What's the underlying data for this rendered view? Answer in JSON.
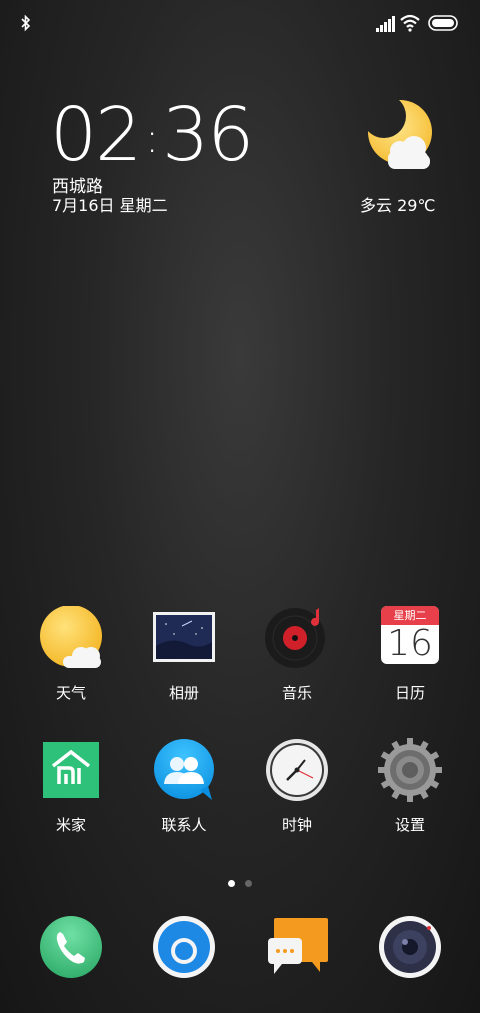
{
  "status_bar": {
    "bluetooth_icon": "bluetooth-icon",
    "signal_icon": "cellular-signal-icon",
    "wifi_icon": "wifi-icon",
    "battery_icon": "battery-icon"
  },
  "lock_widget": {
    "hour": "02",
    "separator": ":",
    "minute": "36",
    "location": "西城路",
    "date": "7月16日 星期二",
    "weather_icon": "moon-cloud-icon",
    "weather": "多云 29℃"
  },
  "apps": [
    {
      "label": "天气",
      "icon": "weather-icon"
    },
    {
      "label": "相册",
      "icon": "gallery-icon"
    },
    {
      "label": "音乐",
      "icon": "music-icon"
    },
    {
      "label": "日历",
      "icon": "calendar-icon",
      "calendar_weekday": "星期二",
      "calendar_day": "16"
    },
    {
      "label": "米家",
      "icon": "mi-home-icon"
    },
    {
      "label": "联系人",
      "icon": "contacts-icon"
    },
    {
      "label": "时钟",
      "icon": "clock-icon"
    },
    {
      "label": "设置",
      "icon": "settings-icon"
    }
  ],
  "page_indicator": {
    "pages": 2,
    "current": 1
  },
  "dock": [
    {
      "icon": "phone-icon"
    },
    {
      "icon": "browser-icon"
    },
    {
      "icon": "messages-icon"
    },
    {
      "icon": "camera-icon"
    }
  ]
}
